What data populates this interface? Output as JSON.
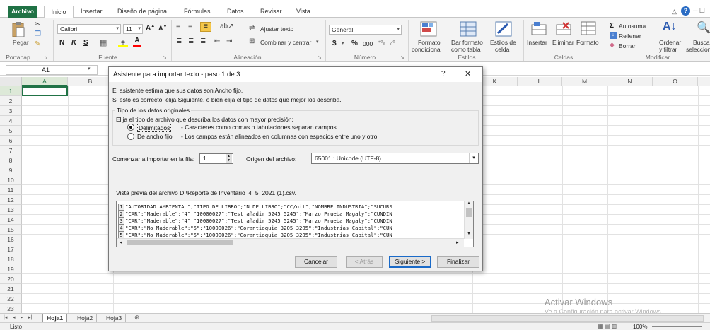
{
  "menu": {
    "file": "Archivo",
    "tabs": [
      "Inicio",
      "Insertar",
      "Diseño de página",
      "Fórmulas",
      "Datos",
      "Revisar",
      "Vista"
    ]
  },
  "ribbon": {
    "paste": "Pegar",
    "clipboard": "Portapap...",
    "font_name": "Calibri",
    "font_size": "11",
    "bold": "N",
    "italic": "K",
    "underline": "S",
    "font_group": "Fuente",
    "wrap_text": "Ajustar texto",
    "merge_center": "Combinar y centrar",
    "alignment_group": "Alineación",
    "number_format": "General",
    "currency": "$",
    "percent": "%",
    "thousands": "000",
    "number_group": "Número",
    "cond_format_1": "Formato",
    "cond_format_2": "condicional",
    "table_format_1": "Dar formato",
    "table_format_2": "como tabla",
    "cell_styles_1": "Estilos de",
    "cell_styles_2": "celda",
    "styles_group": "Estilos",
    "insert": "Insertar",
    "delete": "Eliminar",
    "format": "Formato",
    "cells_group": "Celdas",
    "autosum": "Autosuma",
    "fill": "Rellenar",
    "clear": "Borrar",
    "sort_1": "Ordenar",
    "sort_2": "y filtrar",
    "find_1": "Buscar",
    "find_2": "selecciona",
    "modify_group": "Modificar"
  },
  "formula_bar": {
    "name_box": "A1",
    "fx": "fx"
  },
  "grid": {
    "columns": [
      "A",
      "B",
      "C",
      "D",
      "E",
      "F",
      "G",
      "H",
      "I",
      "J",
      "K",
      "L",
      "M",
      "N",
      "O"
    ],
    "rows": [
      "1",
      "2",
      "3",
      "4",
      "5",
      "6",
      "7",
      "8",
      "9",
      "10",
      "11",
      "12",
      "13",
      "14",
      "15",
      "16",
      "17",
      "18",
      "19",
      "20",
      "21",
      "22",
      "23"
    ]
  },
  "sheets": {
    "tabs": [
      "Hoja1",
      "Hoja2",
      "Hoja3"
    ],
    "active": "Hoja1"
  },
  "status": {
    "ready": "Listo",
    "zoom": "100%"
  },
  "watermark": {
    "line1": "Activar Windows",
    "line2": "Ve a Configuración para activar Windows."
  },
  "dialog": {
    "title": "Asistente para importar texto - paso 1 de 3",
    "help": "?",
    "close": "✕",
    "intro1": "El asistente estima que sus datos son Ancho fijo.",
    "intro2": "Si esto es correcto, elija Siguiente, o bien elija el tipo de datos que mejor los describa.",
    "group_title": "Tipo de los datos originales",
    "choose": "Elija el tipo de archivo que describa los datos con mayor precisión:",
    "opt1_label": "Delimitados",
    "opt1_desc": "- Caracteres como comas o tabulaciones separan campos.",
    "opt2_label": "De ancho fijo",
    "opt2_desc": "- Los campos están alineados en columnas con espacios entre uno y otro.",
    "start_row_label": "Comenzar a importar en la fila:",
    "start_row_value": "1",
    "origin_label": "Origen del archivo:",
    "origin_value": "65001 : Unicode (UTF-8)",
    "preview_label": "Vista previa del archivo D:\\Reporte de Inventario_4_5_2021 (1).csv.",
    "preview_rows": [
      {
        "num": "1",
        "text": "\"AUTORIDAD AMBIENTAL\";\"TIPO DE LIBRO\";\"N DE LIBRO\";\"CC/nit\";\"NOMBRE INDUSTRIA\";\"SUCURS"
      },
      {
        "num": "2",
        "text": "\"CAR\";\"Maderable\";\"4\";\"10000027\";\"Test añadir 5245 5245\";\"Marzo Prueba Magaly\";\"CUNDIN"
      },
      {
        "num": "3",
        "text": "\"CAR\";\"Maderable\";\"4\";\"10000027\";\"Test añadir 5245 5245\";\"Marzo Prueba Magaly\";\"CUNDIN"
      },
      {
        "num": "4",
        "text": "\"CAR\";\"No Maderable\";\"5\";\"10000026\";\"Corantioquia 3205 3205\";\"Industrias Capital\";\"CUN"
      },
      {
        "num": "5",
        "text": "\"CAR\";\"No Maderable\";\"5\";\"10000026\";\"Corantioquia 3205 3205\";\"Industrias Capital\";\"CUN"
      }
    ],
    "cancel": "Cancelar",
    "back": "< Atrás",
    "next": "Siguiente >",
    "finish": "Finalizar"
  }
}
